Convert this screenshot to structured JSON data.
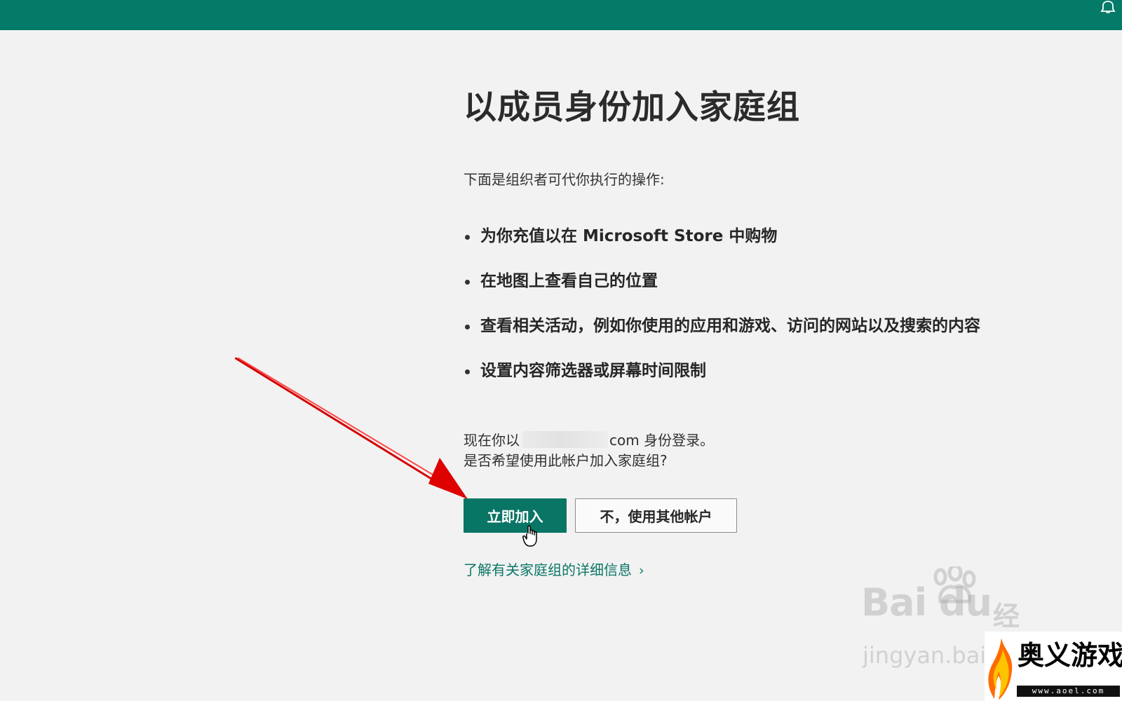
{
  "page": {
    "title": "以成员身份加入家庭组",
    "intro": "下面是组织者可代你执行的操作:"
  },
  "permissions": [
    "为你充值以在 Microsoft Store 中购物",
    "在地图上查看自己的位置",
    "查看相关活动，例如你使用的应用和游戏、访问的网站以及搜索的内容",
    "设置内容筛选器或屏幕时间限制"
  ],
  "account": {
    "prefix": "现在你以",
    "suffix": "com 身份登录。",
    "question": "是否希望使用此帐户加入家庭组?"
  },
  "actions": {
    "join_label": "立即加入",
    "other_account_label": "不，使用其他帐户"
  },
  "learn_more": {
    "label": "了解有关家庭组的详细信息",
    "chevron": "›"
  },
  "watermarks": {
    "baidu_word": "Bai du",
    "baidu_product": "经验",
    "baidu_domain": "jingyan.baidu.com",
    "site_name": "奥义游戏网",
    "site_url": "www.aoel.com"
  },
  "colors": {
    "accent": "#087565",
    "header": "#047a69",
    "annotation": "#e00000"
  },
  "icons": {
    "notification": "bell-icon",
    "cursor": "hand-cursor-icon",
    "arrow": "red-arrow-icon",
    "chevron": "chevron-right-icon"
  }
}
